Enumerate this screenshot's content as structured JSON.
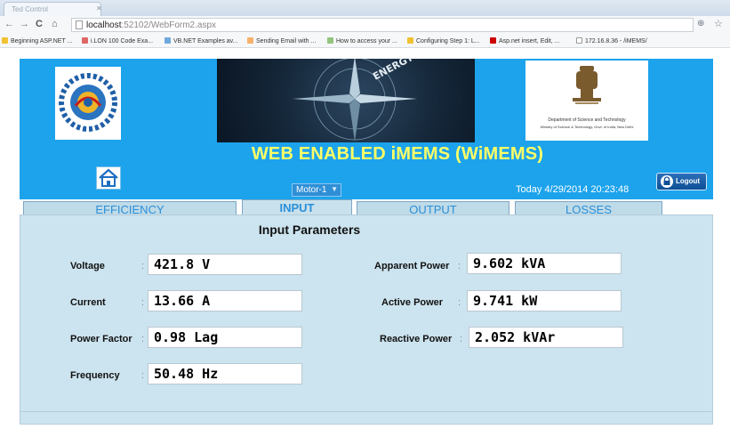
{
  "browser": {
    "tab_title": "Ted Control",
    "address_host": "localhost",
    "address_path": ":52102/WebForm2.aspx",
    "bookmarks": [
      "Beginning ASP.NET ...",
      "i.LON 100 Code Exa...",
      "VB.NET Examples av...",
      "Sending Email with ...",
      "How to access your ...",
      "Configuring Step 1: L...",
      "Asp.net insert, Edit, ...",
      "172.16.8.36 - /iMEMS/"
    ]
  },
  "header": {
    "banner_text": "ENERGY EFFICIENCY",
    "dept_line1": "Department of Science and Technology",
    "dept_line2": "Ministry of Science & Technology, Govt. of India, New Delhi",
    "title": "WEB ENABLED iMEMS (WiMEMS)",
    "motor_select": "Motor-1",
    "timestamp": "Today 4/29/2014 20:23:48",
    "logout_label": "Logout"
  },
  "tabs": [
    {
      "label": "EFFICIENCY",
      "active": false
    },
    {
      "label": "INPUT",
      "active": true
    },
    {
      "label": "OUTPUT",
      "active": false
    },
    {
      "label": "LOSSES",
      "active": false
    }
  ],
  "panel": {
    "title": "Input Parameters",
    "left": [
      {
        "label": "Voltage",
        "value": "421.8 V"
      },
      {
        "label": "Current",
        "value": "13.66 A"
      },
      {
        "label": "Power Factor",
        "value": "0.98 Lag"
      },
      {
        "label": "Frequency",
        "value": "50.48 Hz"
      }
    ],
    "right": [
      {
        "label": "Apparent Power",
        "value": "9.602 kVA"
      },
      {
        "label": "Active Power",
        "value": "9.741 kW"
      },
      {
        "label": "Reactive Power",
        "value": "2.052 kVAr"
      }
    ]
  },
  "colors": {
    "header_bg": "#1ca3ec",
    "title_yellow": "#ffff66",
    "panel_bg": "#cce4ef",
    "tab_text": "#2a8fd8"
  }
}
